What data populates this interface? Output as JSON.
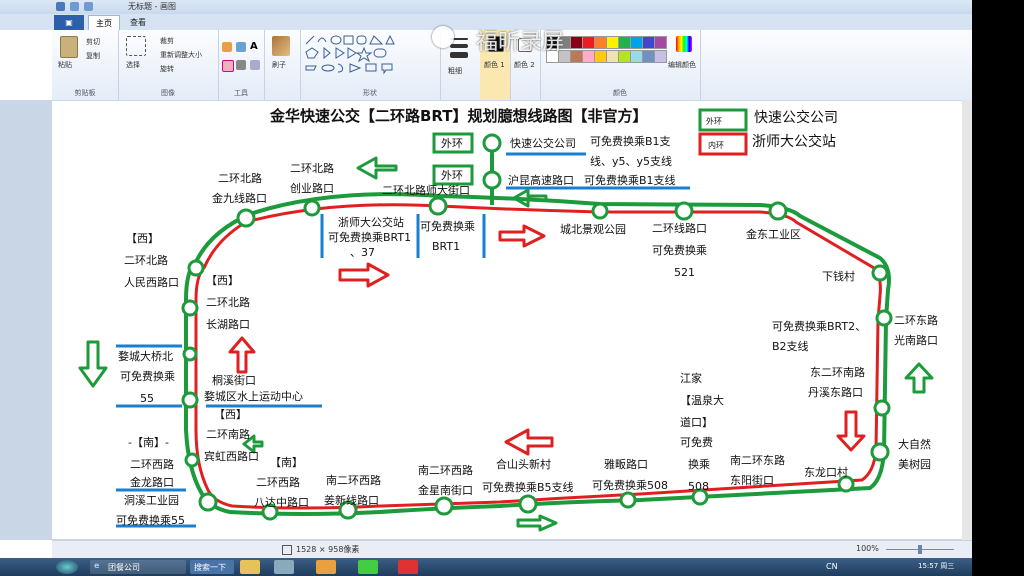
{
  "window": {
    "title": "无标题 - 画图"
  },
  "ribbon": {
    "tabs": {
      "file": "▣",
      "home": "主页",
      "view": "查看"
    },
    "clipboard": {
      "paste": "粘贴",
      "cut": "剪切",
      "copy": "复制",
      "group": "剪贴板"
    },
    "image": {
      "select": "选择",
      "crop": "裁剪",
      "resize": "重新调整大小",
      "rotate": "旋转",
      "group": "图像"
    },
    "tools": {
      "group": "工具"
    },
    "brushes": {
      "label": "刷子"
    },
    "shapes": {
      "group": "形状"
    },
    "size": {
      "label": "粗细"
    },
    "color1": {
      "label": "颜色 1"
    },
    "color2": {
      "label": "颜色 2"
    },
    "colors": {
      "group": "颜色",
      "edit": "编辑颜色"
    },
    "palette": [
      "#000000",
      "#7f7f7f",
      "#880015",
      "#ed1c24",
      "#ff7f27",
      "#fff200",
      "#22b14c",
      "#00a2e8",
      "#3f48cc",
      "#a349a4",
      "#ffffff",
      "#c3c3c3",
      "#b97a57",
      "#ffaec9",
      "#ffc90e",
      "#efe4b0",
      "#b5e61d",
      "#99d9ea",
      "#7092be",
      "#c8bfe7"
    ]
  },
  "watermark": "福昕录屏",
  "status": {
    "size": "1528 × 958像素",
    "zoom": "100%"
  },
  "taskbar": {
    "ie": "团餐公司",
    "search": "搜索一下",
    "time": "15:57 周三",
    "ime": "CN"
  },
  "map": {
    "title": "金华快速公交【二环路BRT】规划臆想线路图【非官方】",
    "legend": {
      "outer_box": "外环",
      "inner_box": "内环",
      "outer_label": "快速公交公司",
      "inner_label": "浙师大公交站"
    },
    "colors": {
      "outer": "#1c9a3c",
      "inner": "#e02020",
      "arrow_green": "#1c9a3c",
      "arrow_red": "#e02020",
      "marker": "#1a7fd0"
    },
    "labels": {
      "waihuan1": "外环",
      "waihuan2": "外环",
      "kuaisu": "快速公交公司",
      "b1a": "可免费换乘B1支",
      "b1b": "线、y5、y5支线",
      "hukun": "沪昆高速路口",
      "hukun_b1": "可免费换乘B1支线",
      "erhuanbei_chuangye_a": "二环北路",
      "erhuanbei_chuangye_b": "创业路口",
      "erhuanbei_jinjiu_a": "二环北路",
      "erhuanbei_jinjiu_b": "金九线路口",
      "shida_jie": "二环北路师大街口",
      "zsd_a": "浙师大公交站",
      "zsd_b": "可免费换乘BRT1",
      "zsd_c": "、37",
      "brt1_a": "可免费换乘",
      "brt1_b": "BRT1",
      "chengbei": "城北景观公园",
      "erhuanxian_a": "二环线路口",
      "erhuanxian_b": "可免费换乘",
      "erhuanxian_c": "521",
      "jindong": "金东工业区",
      "xiaqian": "下钱村",
      "brt2_a": "可免费换乘BRT2、",
      "brt2_b": "B2支线",
      "erhuandong_a": "二环东路",
      "erhuandong_b": "光南路口",
      "danxi_a": "东二环南路",
      "danxi_b": "丹溪东路口",
      "daziran_a": "大自然",
      "daziran_b": "美树园",
      "donglong": "东龙口村",
      "dongyang_a": "南二环东路",
      "dongyang_b": "东阳街口",
      "jiangjia_a": "江家",
      "jiangjia_b": "【温泉大",
      "jiangjia_c": "道口】",
      "jiangjia_d": "可免费",
      "jiangjia_e": "换乘",
      "jiangjia_f": "508",
      "yafan_a": "雅畈路口",
      "yafan_b": "可免费换乘508",
      "heshantou_a": "合山头新村",
      "heshantou_b": "可免费换乘B5支线",
      "jinxing_a": "南二环西路",
      "jinxing_b": "金星南街口",
      "jiangxin_a": "南二环西路",
      "jiangxin_b": "姜新线路口",
      "bada_a": "二环西路",
      "bada_b": "八达中路口",
      "nan2": "【南】",
      "binhong_a": "二环南路",
      "binhong_b": "宾虹西路口",
      "nan1": "-【南】-",
      "erhuan_xi": "二环西路",
      "jinlong": "金龙路口",
      "dongxi": "洞溪工业园",
      "huan55": "可免费换乘55",
      "xi1": "【西】",
      "renmin_a": "二环北路",
      "renmin_b": "人民西路口",
      "xi2": "【西】",
      "changhu_a": "二环北路",
      "changhu_b": "长湖路口",
      "wuqiao_a": "婺城大桥北",
      "wuqiao_b": "可免费换乘",
      "wuqiao_c": "55",
      "tongxi_a": "桐溪街口",
      "tongxi_b": "婺城区水上运动中心",
      "xi3": "【西】"
    }
  }
}
